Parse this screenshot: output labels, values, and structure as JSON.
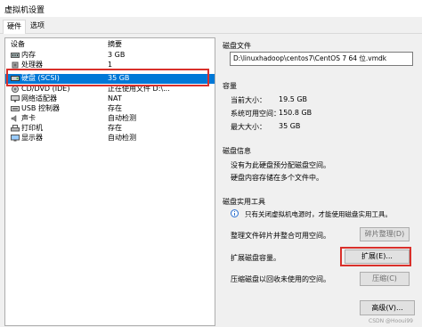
{
  "window": {
    "title": "虚拟机设置"
  },
  "tabs": [
    {
      "label": "硬件"
    },
    {
      "label": "选项"
    }
  ],
  "device_list": {
    "headers": {
      "device": "设备",
      "summary": "摘要"
    },
    "rows": [
      {
        "name": "内存",
        "summary": "3 GB",
        "icon": "memory-icon"
      },
      {
        "name": "处理器",
        "summary": "1",
        "icon": "cpu-icon"
      },
      {
        "name": "硬盘 (SCSI)",
        "summary": "35 GB",
        "icon": "hard-disk-icon",
        "selected": true
      },
      {
        "name": "CD/DVD (IDE)",
        "summary": "正在使用文件 D:\\...",
        "icon": "cd-dvd-icon"
      },
      {
        "name": "网络适配器",
        "summary": "NAT",
        "icon": "network-adapter-icon"
      },
      {
        "name": "USB 控制器",
        "summary": "存在",
        "icon": "usb-controller-icon"
      },
      {
        "name": "声卡",
        "summary": "自动检测",
        "icon": "sound-card-icon"
      },
      {
        "name": "打印机",
        "summary": "存在",
        "icon": "printer-icon"
      },
      {
        "name": "显示器",
        "summary": "自动检测",
        "icon": "display-icon"
      }
    ]
  },
  "disk_file": {
    "title": "磁盘文件",
    "path": "D:\\linuxhadoop\\centos7\\CentOS 7 64 位.vmdk"
  },
  "capacity": {
    "title": "容量",
    "current_size_label": "当前大小：",
    "current_size": "19.5 GB",
    "free_space_label": "系统可用空间：",
    "free_space": "150.8 GB",
    "max_size_label": "最大大小：",
    "max_size": "35 GB"
  },
  "disk_info": {
    "title": "磁盘信息",
    "line1": "没有为此硬盘预分配磁盘空间。",
    "line2": "硬盘内容存储在多个文件中。"
  },
  "disk_tools": {
    "title": "磁盘实用工具",
    "note": "只有关闭虚拟机电源时，才能使用磁盘实用工具。",
    "defragment_text": "整理文件碎片并整合可用空间。",
    "defragment_button": "碎片整理(D)",
    "expand_text": "扩展磁盘容量。",
    "expand_button": "扩展(E)...",
    "compact_text": "压缩磁盘以回收未使用的空间。",
    "compact_button": "压缩(C)"
  },
  "advanced_button": "高级(V)...",
  "watermark": "CSDN @Hooui99"
}
